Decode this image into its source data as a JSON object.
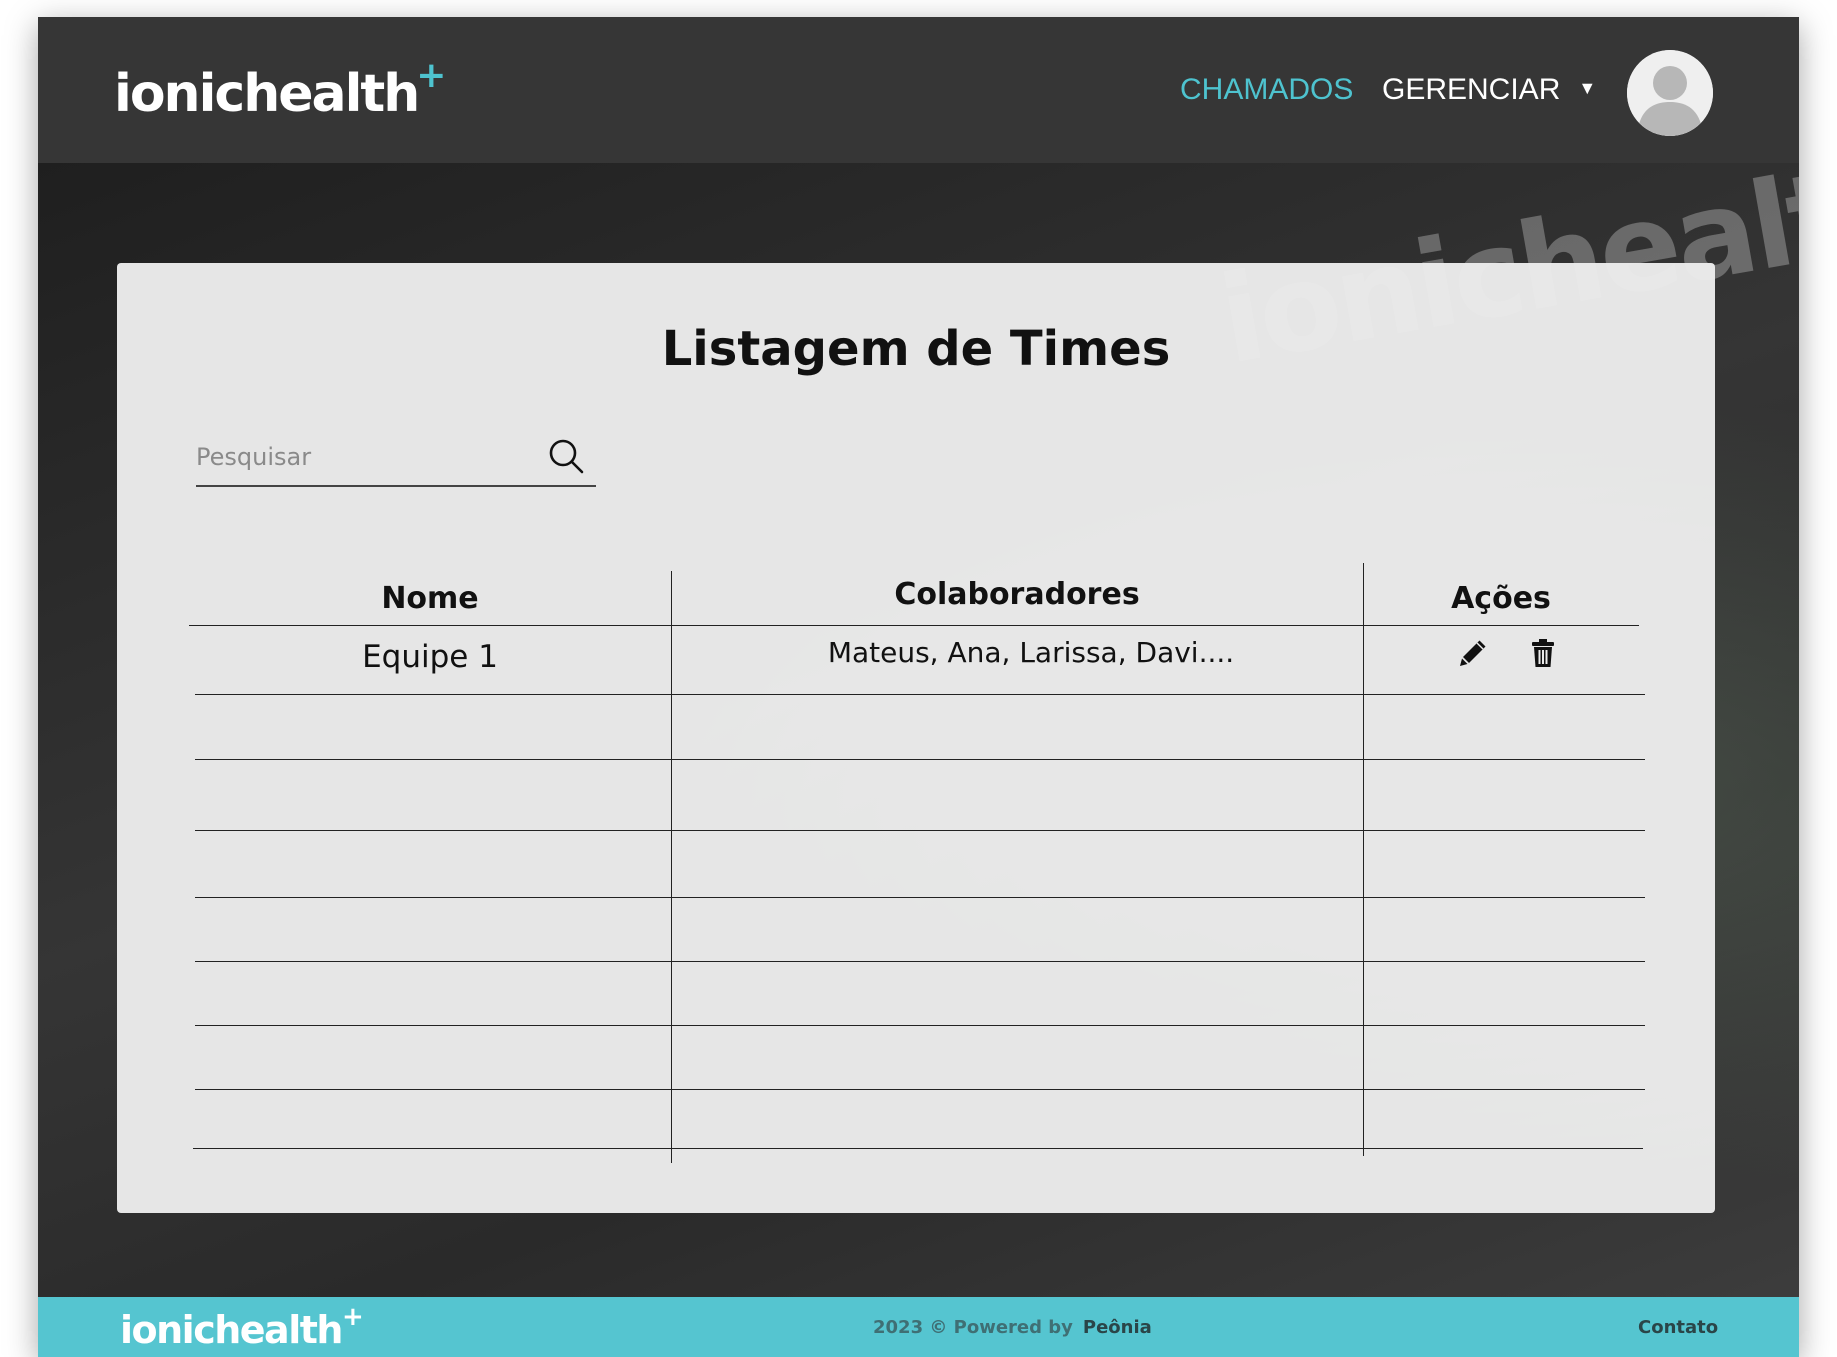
{
  "header": {
    "logo_text": "ionichealth",
    "logo_mark": "+",
    "nav": {
      "chamados": "CHAMADOS",
      "gerenciar": "GERENCIAR",
      "gerenciar_caret": "▼"
    },
    "avatar_icon": "user-avatar-icon"
  },
  "background": {
    "wall_text": "ionichealt"
  },
  "main": {
    "title": "Listagem de Times",
    "search": {
      "placeholder": "Pesquisar",
      "value": "",
      "icon": "search-icon"
    },
    "table": {
      "columns": [
        "Nome",
        "Colaboradores",
        "Ações"
      ],
      "rows": [
        {
          "nome": "Equipe 1",
          "colaboradores": "Mateus, Ana, Larissa, Davi....",
          "actions": [
            "pencil-icon",
            "trash-icon"
          ]
        }
      ],
      "empty_rows": 7
    }
  },
  "footer": {
    "logo_text": "ionichealth",
    "logo_mark": "+",
    "copyright": "2023 © Powered by",
    "brand": "Peônia",
    "contact": "Contato"
  },
  "colors": {
    "accent": "#4ec3cf",
    "header_bg": "#363636",
    "footer_bg": "#55c5d0",
    "card_bg": "#ececec"
  }
}
